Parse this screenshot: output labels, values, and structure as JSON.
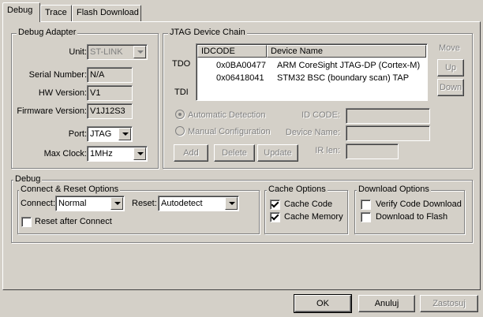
{
  "tabs": [
    {
      "label": "Debug"
    },
    {
      "label": "Trace"
    },
    {
      "label": "Flash Download"
    }
  ],
  "debug_adapter": {
    "title": "Debug Adapter",
    "unit_label": "Unit:",
    "unit_value": "ST-LINK",
    "serial_label": "Serial Number:",
    "serial_value": "N/A",
    "hw_label": "HW Version:",
    "hw_value": "V1",
    "fw_label": "Firmware Version:",
    "fw_value": "V1J12S3",
    "port_label": "Port:",
    "port_value": "JTAG",
    "clock_label": "Max Clock:",
    "clock_value": "1MHz"
  },
  "jtag": {
    "title": "JTAG Device Chain",
    "tdo": "TDO",
    "tdi": "TDI",
    "col_idcode": "IDCODE",
    "col_device": "Device Name",
    "rows": [
      {
        "idcode": "0x0BA00477",
        "device": "ARM CoreSight JTAG-DP (Cortex-M)"
      },
      {
        "idcode": "0x06418041",
        "device": "STM32 BSC (boundary scan) TAP"
      }
    ],
    "move_label": "Move",
    "up_label": "Up",
    "down_label": "Down",
    "auto_label": "Automatic Detection",
    "manual_label": "Manual Configuration",
    "idcode_label": "ID CODE:",
    "devname_label": "Device Name:",
    "irlen_label": "IR len:",
    "add_label": "Add",
    "delete_label": "Delete",
    "update_label": "Update"
  },
  "debug": {
    "title": "Debug",
    "connect_group": "Connect & Reset Options",
    "connect_label": "Connect:",
    "connect_value": "Normal",
    "reset_label": "Reset:",
    "reset_value": "Autodetect",
    "reset_after_label": "Reset after Connect",
    "cache_group": "Cache Options",
    "cache_code_label": "Cache Code",
    "cache_memory_label": "Cache Memory",
    "download_group": "Download Options",
    "verify_label": "Verify Code Download",
    "download_flash_label": "Download to Flash"
  },
  "footer": {
    "ok_label": "OK",
    "cancel_label": "Anuluj",
    "apply_label": "Zastosuj"
  }
}
